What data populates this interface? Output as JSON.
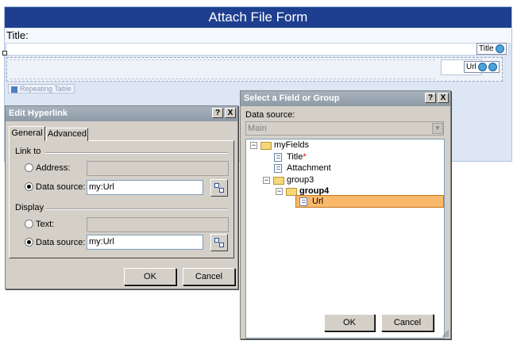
{
  "form": {
    "header": "Attach File Form",
    "title_label": "Title:",
    "title_control": "Title",
    "url_control": "Url",
    "repeating_table_label": "Repeating Table"
  },
  "edit_hyperlink": {
    "title": "Edit Hyperlink",
    "help_btn": "?",
    "close_btn": "X",
    "tabs": [
      "General",
      "Advanced"
    ],
    "link_to": {
      "group_label": "Link to",
      "address_label": "Address:",
      "address_value": "",
      "datasource_label": "Data source:",
      "datasource_value": "my:Url"
    },
    "display": {
      "group_label": "Display",
      "text_label": "Text:",
      "text_value": "",
      "datasource_label": "Data source:",
      "datasource_value": "my:Url"
    },
    "ok": "OK",
    "cancel": "Cancel"
  },
  "select_field": {
    "title": "Select a Field or Group",
    "help_btn": "?",
    "close_btn": "X",
    "datasource_label": "Data source:",
    "datasource_value": "Main",
    "tree": {
      "root": "myFields",
      "title": "Title",
      "required_mark": "*",
      "attachment": "Attachment",
      "group3": "group3",
      "group4": "group4",
      "url": "Url"
    },
    "ok": "OK",
    "cancel": "Cancel"
  },
  "colors": {
    "header_bg": "#1e3f8f",
    "selection": "#f9b86a",
    "dialog_bg": "#d4d0c8"
  }
}
